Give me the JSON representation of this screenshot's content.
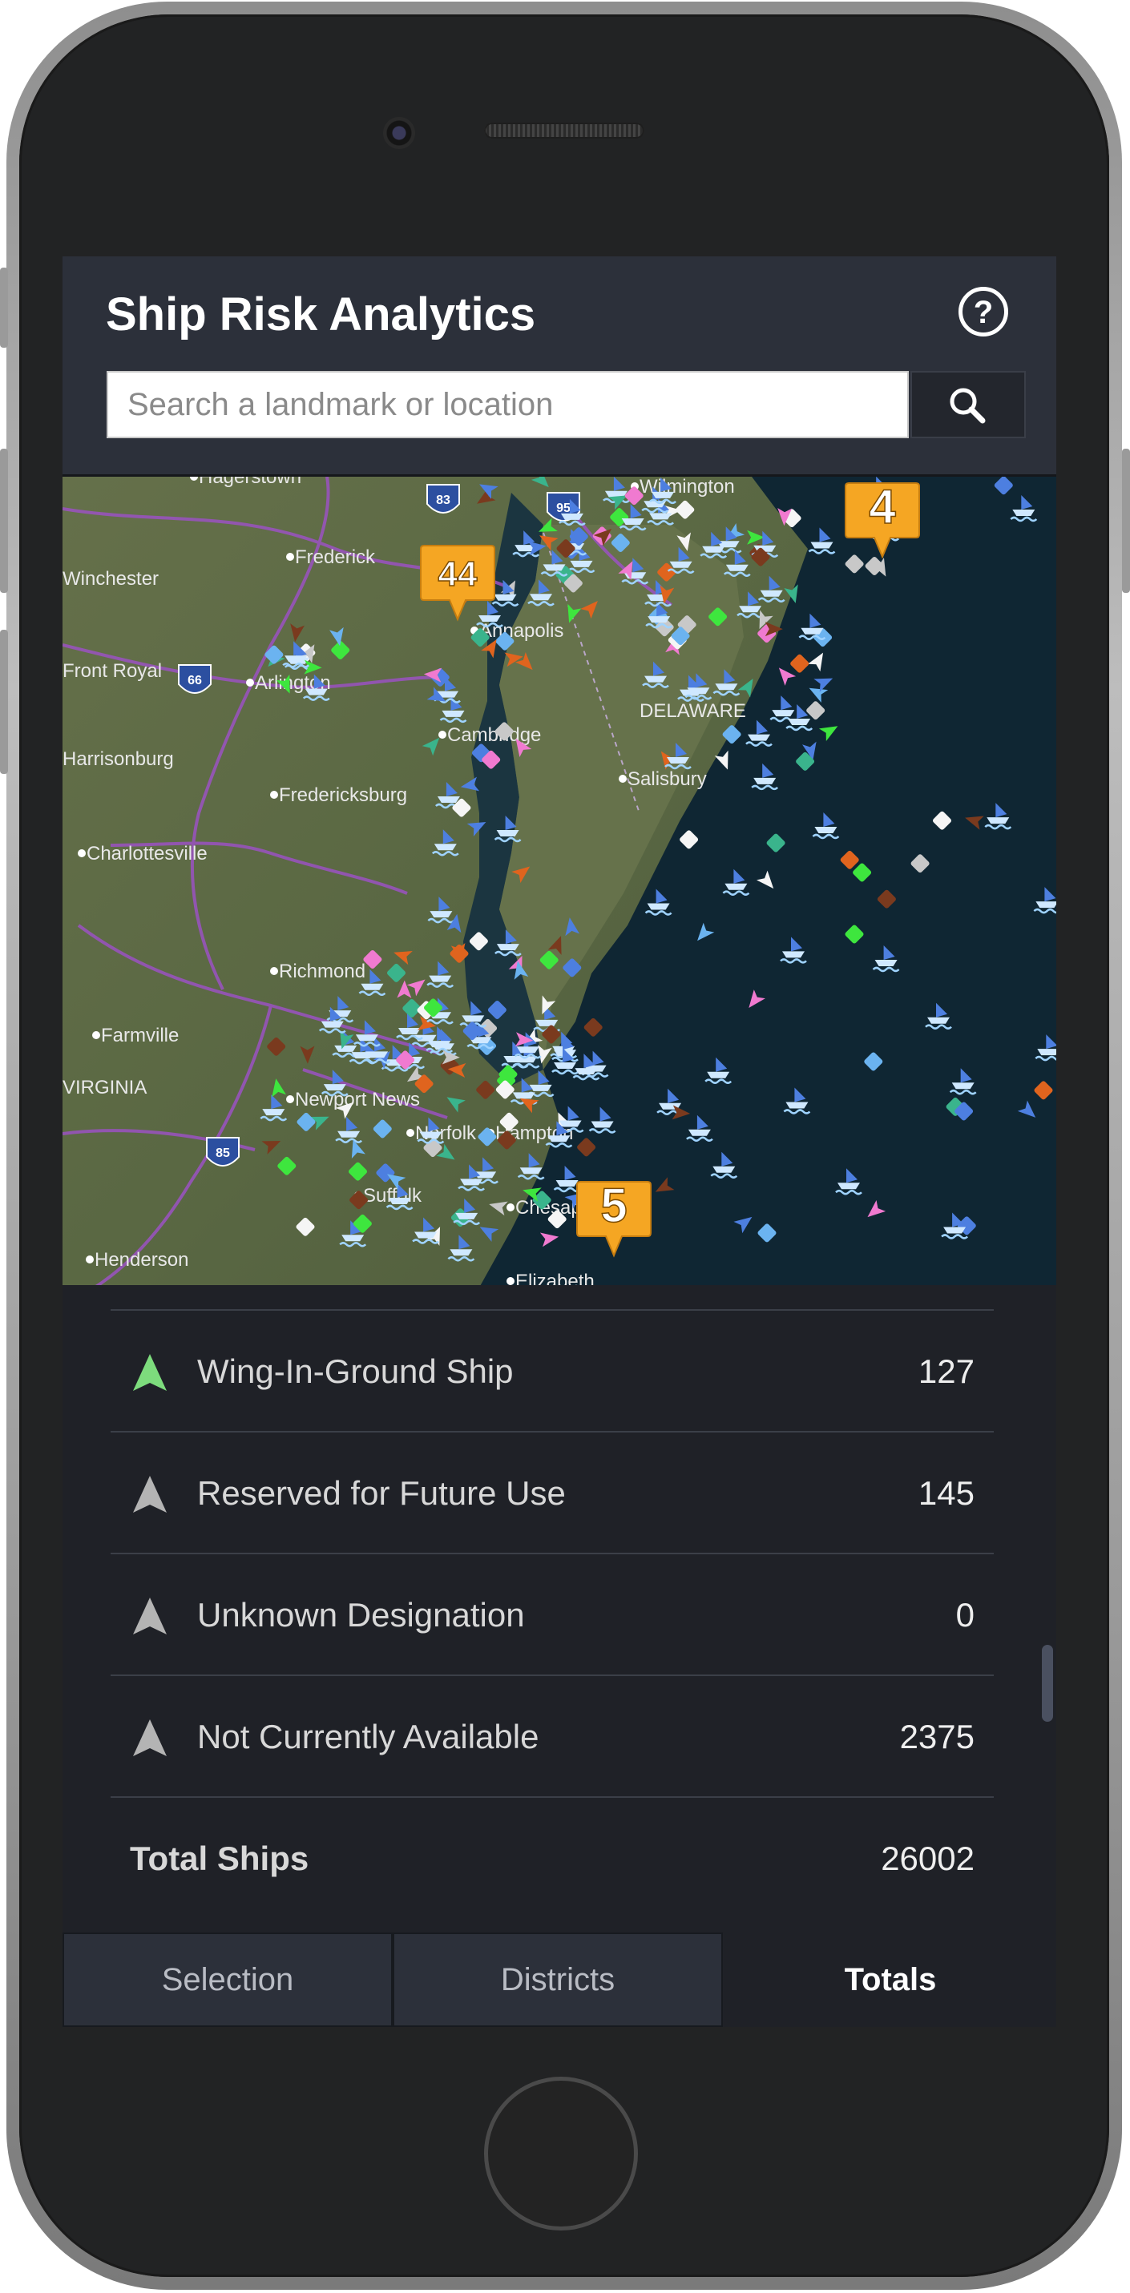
{
  "app": {
    "title": "Ship Risk Analytics",
    "help_icon": "question-circle-icon",
    "help_glyph": "?"
  },
  "search": {
    "placeholder": "Search a landmark or location",
    "value": "",
    "button_icon": "search-icon"
  },
  "map": {
    "city_labels": [
      "Wilmington",
      "Frederick",
      "Winchester",
      "Annapolis",
      "Front Royal",
      "Arlington",
      "Harrisonburg",
      "Cambridge",
      "Fredericksburg",
      "Salisbury",
      "Charlottesville",
      "Richmond",
      "Farmville",
      "Newport News",
      "Norfolk",
      "Hampton",
      "Suffolk",
      "Chesapeake",
      "Henderson",
      "Elizabeth",
      "DELAWARE",
      "Hagerstown",
      "VIRGINIA"
    ],
    "highway_shields": [
      "83",
      "95",
      "66",
      "85"
    ],
    "cluster_markers": [
      "44",
      "4",
      "5"
    ],
    "colors": {
      "water": "#0f2a3a",
      "land": "#5e6b45",
      "cluster": "#f5a623",
      "roads": "#a14fc9"
    }
  },
  "ship_types": [
    {
      "label": "Wing-In-Ground Ship",
      "count": "127",
      "icon": "ship-arrow-icon",
      "color": "#7ddc7d"
    },
    {
      "label": "Reserved for Future Use",
      "count": "145",
      "icon": "ship-arrow-icon",
      "color": "#b4b4b4"
    },
    {
      "label": "Unknown Designation",
      "count": "0",
      "icon": "ship-arrow-icon",
      "color": "#b4b4b4"
    },
    {
      "label": "Not Currently Available",
      "count": "2375",
      "icon": "ship-arrow-icon",
      "color": "#b4b4b4"
    }
  ],
  "totals": {
    "label": "Total Ships",
    "value": "26002"
  },
  "tabs": [
    {
      "label": "Selection",
      "active": false
    },
    {
      "label": "Districts",
      "active": false
    },
    {
      "label": "Totals",
      "active": true
    }
  ]
}
